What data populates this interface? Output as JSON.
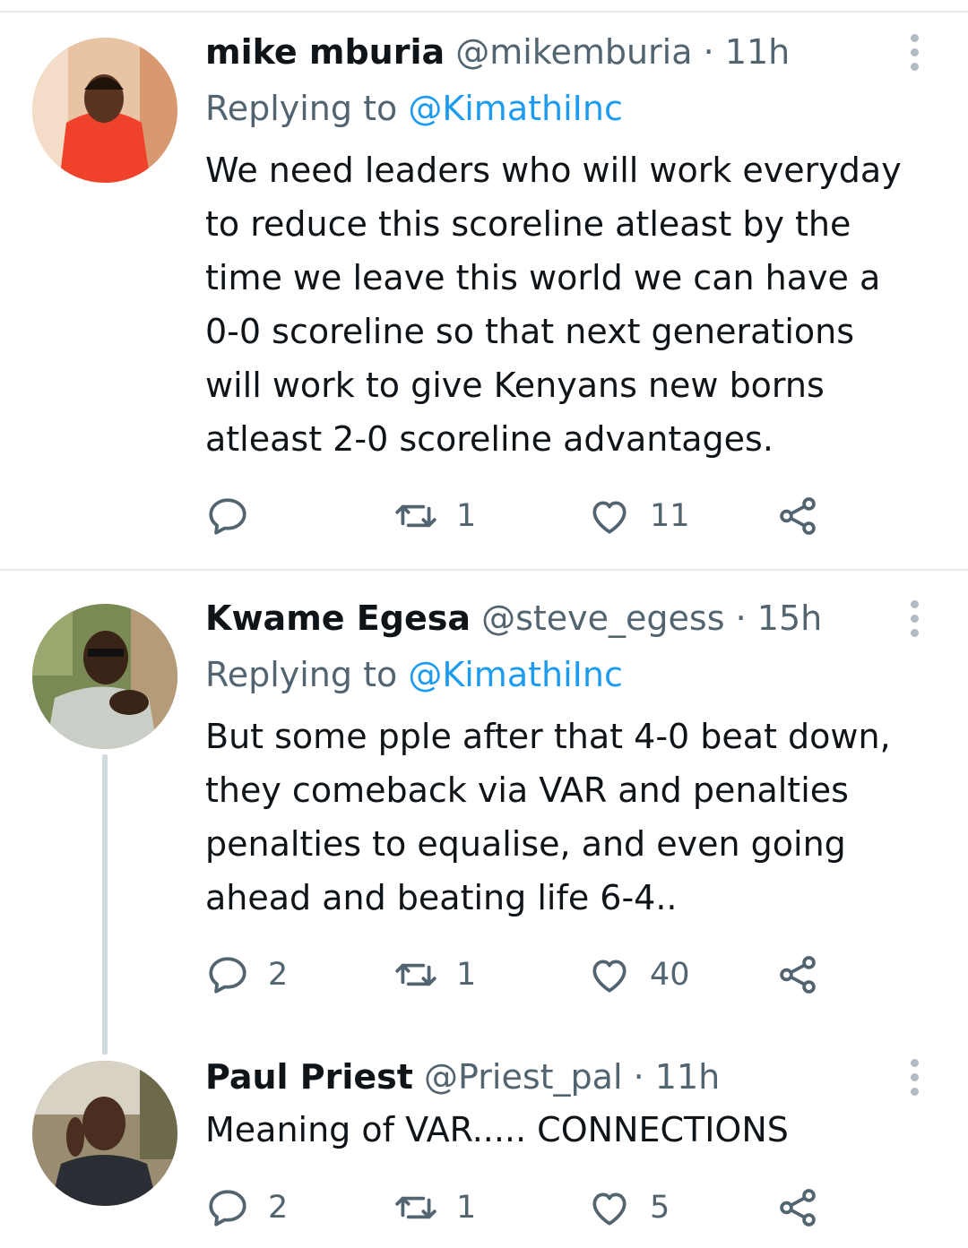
{
  "tweets": [
    {
      "name": "mike mburia",
      "handle": "@mikemburia",
      "separator": "·",
      "time": "11h",
      "replying_prefix": "Replying to",
      "replying_to": "@KimathiInc",
      "lines": [
        "We need leaders who will work everyday",
        "to reduce this scoreline atleast by the",
        "time we leave this world we can have a",
        "0-0 scoreline so that next generations",
        "will work to give Kenyans new borns",
        "atleast 2-0 scoreline advantages."
      ],
      "reply_count": "",
      "retweet_count": "1",
      "like_count": "11",
      "avatar_colors": {
        "bg": "#d9a07a",
        "shirt": "#f0422a",
        "skin": "#5a3420"
      }
    },
    {
      "name": "Kwame Egesa",
      "handle": "@steve_egess",
      "separator": "·",
      "time": "15h",
      "replying_prefix": "Replying to",
      "replying_to": "@KimathiInc",
      "lines": [
        "But some pple after that 4-0 beat down,",
        "they comeback via VAR and penalties",
        "penalties to equalise, and  even going",
        "ahead and beating life 6-4.."
      ],
      "reply_count": "2",
      "retweet_count": "1",
      "like_count": "40",
      "avatar_colors": {
        "bg": "#7a8a55",
        "shirt": "#c9cfc7",
        "skin": "#3a2418"
      }
    },
    {
      "name": "Paul Priest",
      "handle": "@Priest_pal",
      "separator": "·",
      "time": "11h",
      "lines": [
        "Meaning of VAR..... CONNECTIONS"
      ],
      "reply_count": "2",
      "retweet_count": "1",
      "like_count": "5",
      "avatar_colors": {
        "bg": "#9a8c70",
        "shirt": "#2a2d33",
        "skin": "#4a2e20"
      }
    }
  ],
  "icons": {
    "reply": "reply-icon",
    "retweet": "retweet-icon",
    "like": "heart-icon",
    "share": "share-icon",
    "more": "more-vertical-icon"
  },
  "colors": {
    "link": "#1d9bf0",
    "secondary_text": "#536471",
    "primary_text": "#0f1419",
    "divider": "#e7e9eb",
    "thread_line": "#cfd9de"
  }
}
